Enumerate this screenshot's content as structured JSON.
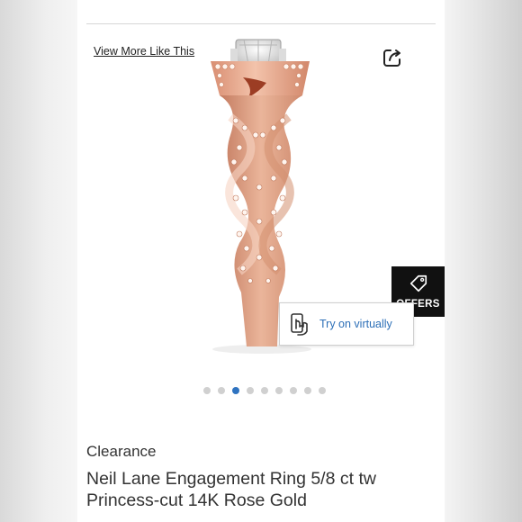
{
  "links": {
    "view_more": "View More Like This"
  },
  "icons": {
    "share": "share-icon",
    "try_on": "hand-phone-icon",
    "offers": "tag-icon"
  },
  "try_on": {
    "label": "Try on virtually"
  },
  "offers": {
    "label": "OFFERS"
  },
  "carousel": {
    "total": 9,
    "active_index": 2
  },
  "product": {
    "badge": "Clearance",
    "title_line1": "Neil Lane Engagement Ring 5/8 ct tw",
    "title_line2": "Princess-cut 14K Rose Gold"
  },
  "colors": {
    "rose_gold": "#e7ae93",
    "link_blue": "#2c6fb7",
    "active_dot": "#2f73c0",
    "offers_bg": "#111111"
  }
}
